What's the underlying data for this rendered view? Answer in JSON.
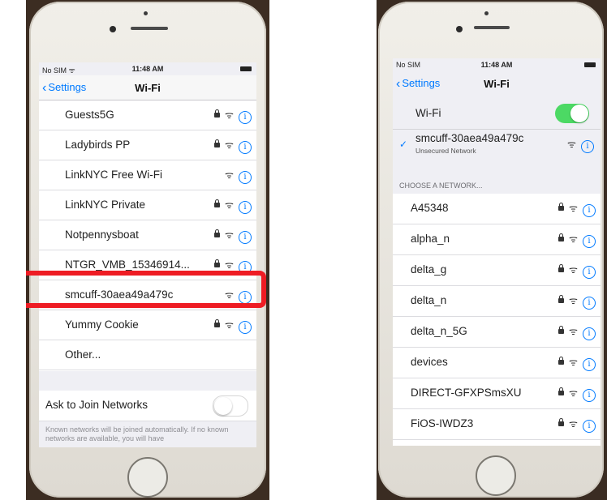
{
  "colors": {
    "accent": "#007aff",
    "toggle_on": "#4cd964",
    "highlight": "#ee1c24"
  },
  "left_phone": {
    "status": {
      "carrier": "No SIM ᯤ",
      "time": "11:48 AM"
    },
    "nav": {
      "back_label": "Settings",
      "title": "Wi-Fi"
    },
    "networks": [
      {
        "name": "Guests5G",
        "locked": true
      },
      {
        "name": "Ladybirds PP",
        "locked": true
      },
      {
        "name": "LinkNYC Free Wi-Fi",
        "locked": false
      },
      {
        "name": "LinkNYC Private",
        "locked": true
      },
      {
        "name": "Notpennysboat",
        "locked": true
      },
      {
        "name": "NTGR_VMB_15346914...",
        "locked": true
      },
      {
        "name": "smcuff-30aea49a479c",
        "locked": false,
        "highlighted": true
      },
      {
        "name": "Yummy Cookie",
        "locked": true
      },
      {
        "name": "Other...",
        "locked": false,
        "no_icons": true
      }
    ],
    "ask_to_join": {
      "label": "Ask to Join Networks",
      "enabled": false
    },
    "footnote": "Known networks will be joined automatically. If no known networks are available, you will have"
  },
  "right_phone": {
    "status": {
      "carrier": "No SIM",
      "time": "11:48 AM"
    },
    "nav": {
      "back_label": "Settings",
      "title": "Wi-Fi"
    },
    "wifi_toggle": {
      "label": "Wi-Fi",
      "enabled": true
    },
    "connected": {
      "name": "smcuff-30aea49a479c",
      "subtitle": "Unsecured Network"
    },
    "section_header": "CHOOSE A NETWORK...",
    "networks": [
      {
        "name": "A45348"
      },
      {
        "name": "alpha_n"
      },
      {
        "name": "delta_g"
      },
      {
        "name": "delta_n"
      },
      {
        "name": "delta_n_5G"
      },
      {
        "name": "devices"
      },
      {
        "name": "DIRECT-GFXPSmsXU"
      },
      {
        "name": "FiOS-IWDZ3"
      }
    ]
  },
  "icons": {
    "lock": "lock-icon",
    "wifi": "wifi-icon",
    "info": "info-icon",
    "chevron": "chevron-left-icon",
    "check": "checkmark-icon"
  }
}
